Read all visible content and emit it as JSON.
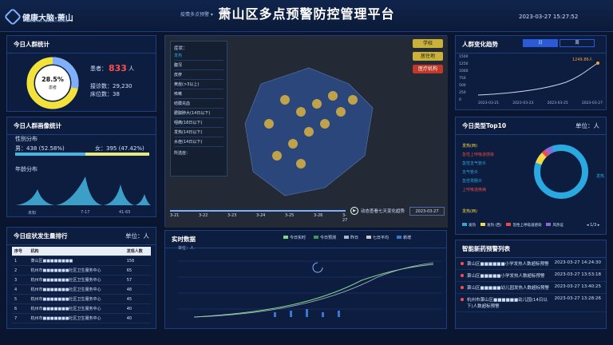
{
  "header": {
    "logo_text": "健康大脑·萧山",
    "logo_sub": "XIAOSHAN HEALTHY BRAIN",
    "nav_dropdown": "疫情多点预警 ▾",
    "title": "萧山区多点预警防控管理平台",
    "datetime": "2023-03-27 15:27:52"
  },
  "today_stats": {
    "title": "今日人群统计",
    "ring_percent": "28.5%",
    "ring_sub": "患者",
    "ring_fraction": 0.285,
    "patients_label": "患者：",
    "patients_value": "833",
    "patients_unit": "人",
    "visits_label": "接诊数：",
    "visits_value": "29,230",
    "beds_label": "床位数：",
    "beds_value": "38"
  },
  "portrait": {
    "title": "今日人群画像统计",
    "gender_title": "性别分布",
    "male_label": "男：438 (52.58%)",
    "female_label": "女：395 (47.42%)",
    "male_fraction": 0.5258,
    "age_title": "年龄分布",
    "age_ticks": [
      "未知",
      "7-17",
      "41-65"
    ]
  },
  "ranking": {
    "title": "今日症状发生量排行",
    "unit": "单位：人",
    "columns": [
      "序号",
      "机构",
      "发现人数"
    ],
    "rows": [
      [
        "1",
        "萧山区■■■■■■■■",
        "156"
      ],
      [
        "2",
        "杭州市■■■■■■■社区卫生服务中心",
        "65"
      ],
      [
        "3",
        "杭州市■■■■■■■社区卫生服务中心",
        "57"
      ],
      [
        "4",
        "杭州市■■■■■■■社区卫生服务中心",
        "48"
      ],
      [
        "5",
        "杭州市■■■■■■■社区卫生服务中心",
        "45"
      ],
      [
        "6",
        "杭州市■■■■■■■社区卫生服务中心",
        "40"
      ],
      [
        "7",
        "杭州市■■■■■■■社区卫生服务中心",
        "40"
      ]
    ]
  },
  "map": {
    "symptom_label": "症状：",
    "symptoms": [
      "发热",
      "腹泻",
      "皮疹",
      "黄疸(>3以上)",
      "咳嗽",
      "结膜充血",
      "腮腺肿大(14日以下)",
      "咽痛(18日以下)",
      "发热(14日以下)",
      "水痘(14日以下)"
    ],
    "symptom_footer": "所选症：",
    "buttons": {
      "school": "学校",
      "community": "居住地",
      "medical": "医疗机构"
    },
    "timeline": [
      "3-21",
      "3-22",
      "3-23",
      "3-24",
      "3-25",
      "3-26",
      "3-27"
    ],
    "play_label": "动态查看七天变化趋势",
    "date_value": "2023-03-27"
  },
  "realtime": {
    "title": "实时数据",
    "unit": "单位：人",
    "legend": [
      "今日实时",
      "今日预测",
      "昨日",
      "七日平均",
      "新增"
    ]
  },
  "trend": {
    "title": "人群变化趋势",
    "tab_day": "日",
    "tab_week": "周",
    "peak_label": "1249.86人",
    "y_ticks": [
      "1500",
      "1250",
      "1000",
      "750",
      "500",
      "250",
      "0"
    ],
    "x_ticks": [
      "2023-03-21",
      "2023-03-23",
      "2023-03-25",
      "2023-03-27"
    ]
  },
  "top10": {
    "title": "今日类型Top10",
    "unit": "单位：人",
    "labels": [
      "发热(西)",
      "急性上呼吸道感染",
      "急性支气管炎",
      "支气管炎",
      "急性胃肠炎",
      "上呼吸道疾病",
      "发热(西)"
    ],
    "ring_label": "发热",
    "legend": [
      "发热",
      "发热 (西)",
      "急性上呼吸道感染",
      "风热证"
    ],
    "pager": "1/3",
    "colors": [
      "#2aa8e0",
      "#f2d84b",
      "#e94b4b",
      "#8a6ad8"
    ]
  },
  "alerts": {
    "title": "智能新药预警列表",
    "items": [
      {
        "text": "萧山区■■■■■■小学发热人数超标预警",
        "time": "2023-03-27 14:24:30"
      },
      {
        "text": "萧山区■■■■■小学发热人数超标预警",
        "time": "2023-03-27 13:53:18"
      },
      {
        "text": "萧山区■■■■■幼儿园发热人数超标预警",
        "time": "2023-03-27 13:40:25"
      },
      {
        "text": "杭州市萧山区■■■■■■幼儿园(14日以下)人数超标预警",
        "time": "2023-03-27 13:28:26"
      }
    ]
  }
}
